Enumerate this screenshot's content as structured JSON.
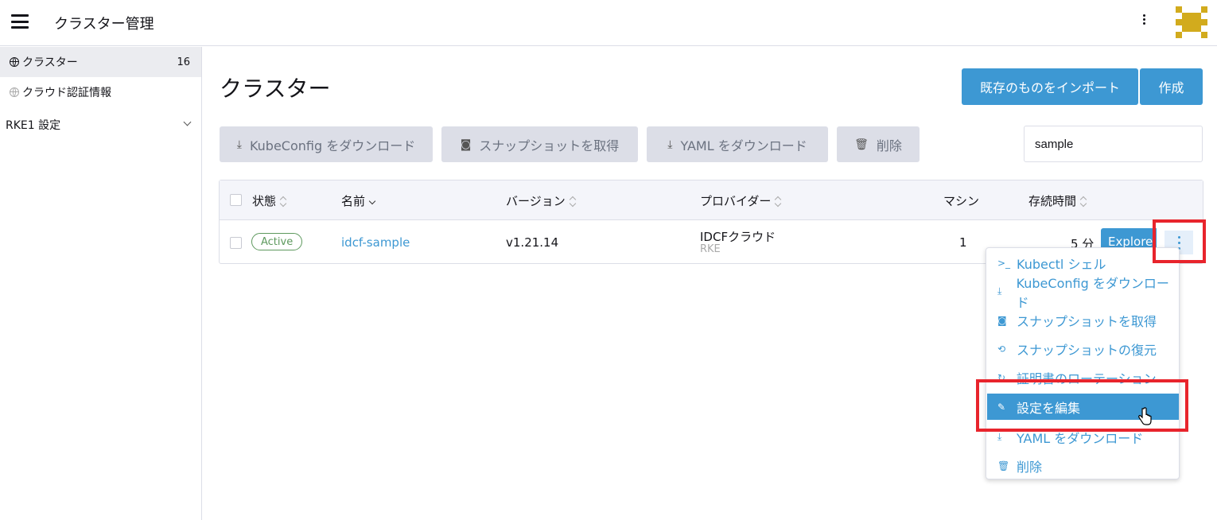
{
  "header": {
    "title": "クラスター管理"
  },
  "sidebar": {
    "items": [
      {
        "label": "クラスター",
        "count": "16"
      },
      {
        "label": "クラウド認証情報"
      }
    ],
    "group_label": "RKE1 設定"
  },
  "main": {
    "title": "クラスター",
    "import_label": "既存のものをインポート",
    "create_label": "作成",
    "bulk": {
      "kubeconfig_label": "KubeConfig をダウンロード",
      "snapshot_label": "スナップショットを取得",
      "yaml_label": "YAML をダウンロード",
      "delete_label": "削除"
    },
    "search": {
      "value": "sample"
    },
    "columns": [
      "状態",
      "名前",
      "バージョン",
      "プロバイダー",
      "マシン",
      "存続時間"
    ],
    "rows": [
      {
        "state": "Active",
        "name": "idcf-sample",
        "version": "v1.21.14",
        "provider": "IDCFクラウド",
        "provider_sub": "RKE",
        "machines": "1",
        "age": "5 分",
        "explore_label": "Explore"
      }
    ]
  },
  "menu": {
    "items": [
      {
        "label": "Kubectl シェル",
        "icon": "terminal-icon"
      },
      {
        "label": "KubeConfig をダウンロード",
        "icon": "download-icon"
      },
      {
        "label": "スナップショットを取得",
        "icon": "camera-icon"
      },
      {
        "label": "スナップショットの復元",
        "icon": "restore-icon"
      },
      {
        "label": "証明書のローテーション",
        "icon": "refresh-icon"
      },
      {
        "label": "設定を編集",
        "icon": "edit-icon"
      },
      {
        "label": "YAML をダウンロード",
        "icon": "download-icon"
      },
      {
        "label": "削除",
        "icon": "trash-icon"
      }
    ]
  },
  "colors": {
    "primary": "#3d98d3",
    "active_badge": "#5d995d",
    "highlight_box": "#e8242c",
    "avatar": "#d2ab1d"
  }
}
